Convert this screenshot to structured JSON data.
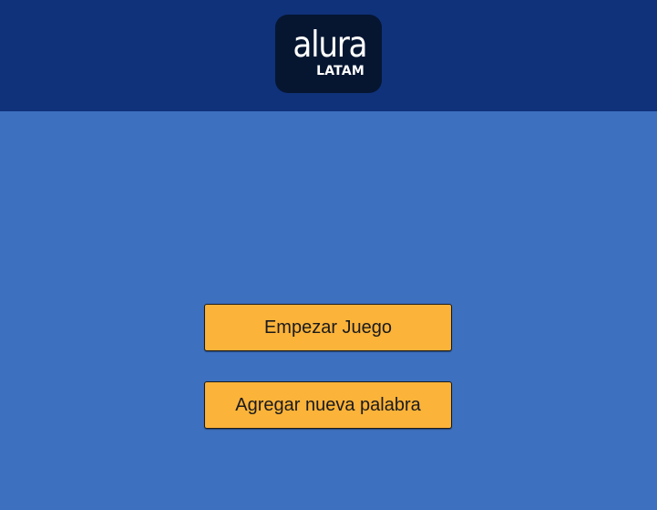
{
  "header": {
    "logo": {
      "word": "alura",
      "sub": "LATAM"
    }
  },
  "menu": {
    "start_label": "Empezar Juego",
    "add_label": "Agregar nueva palabra"
  },
  "colors": {
    "header_bg": "#10327a",
    "page_bg": "#3d70be",
    "logo_bg": "#061631",
    "button_bg": "#fbb33a"
  }
}
